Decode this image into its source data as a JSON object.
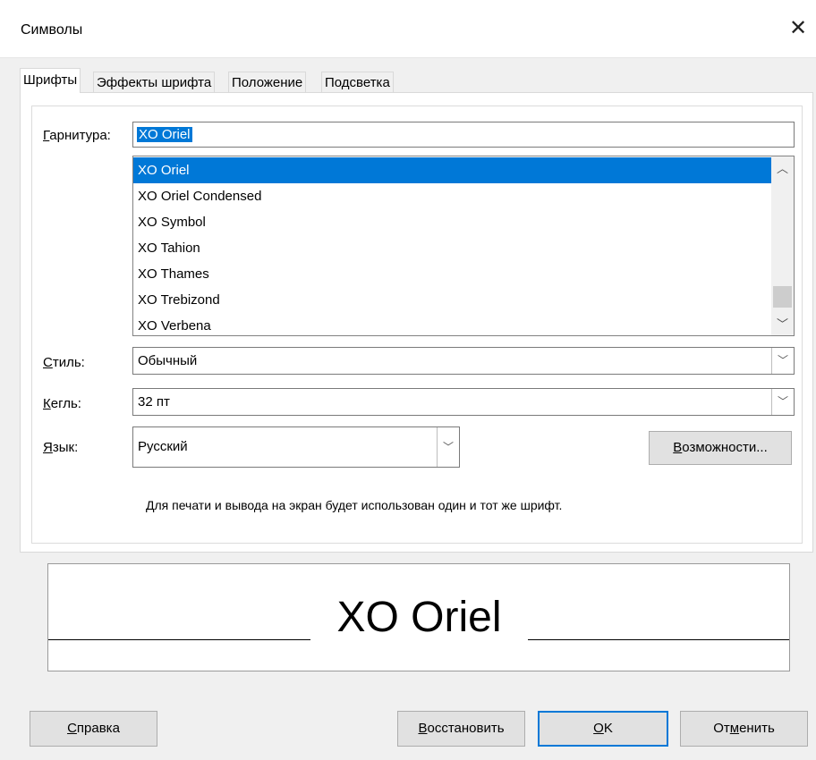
{
  "window": {
    "title": "Символы",
    "close_glyph": "✕"
  },
  "tabs": [
    {
      "label": "Шрифты",
      "active": true
    },
    {
      "label": "Эффекты шрифта",
      "active": false
    },
    {
      "label": "Положение",
      "active": false
    },
    {
      "label": "Подсветка",
      "active": false
    }
  ],
  "font": {
    "family_label_u": "Г",
    "family_label_rest": "арнитура:",
    "family_value": "XO Oriel",
    "family_list": [
      "XO Oriel",
      "XO Oriel Condensed",
      "XO Symbol",
      "XO Tahion",
      "XO Thames",
      "XO Trebizond",
      "XO Verbena"
    ],
    "selected_index": 0,
    "scroll_up_glyph": "︿",
    "scroll_down_glyph": "﹀",
    "style_label_u": "С",
    "style_label_rest": "тиль:",
    "style_value": "Обычный",
    "size_label_u": "К",
    "size_label_rest": "егль:",
    "size_value": "32 пт",
    "lang_label_u": "Я",
    "lang_label_rest": "зык:",
    "lang_value": "Русский",
    "features_button_u": "В",
    "features_button_rest": "озможности...",
    "info_text": "Для печати и вывода на экран будет использован один и тот же шрифт.",
    "dropdown_glyph": "﹀"
  },
  "preview": {
    "text": "XO Oriel"
  },
  "buttons": {
    "help_u": "С",
    "help_rest": "правка",
    "reset_u": "В",
    "reset_rest": "осстановить",
    "ok_u": "О",
    "ok_rest": "K",
    "cancel_pre": "От",
    "cancel_u": "м",
    "cancel_rest": "енить"
  },
  "colors": {
    "selection": "#0078d7",
    "default_button_border": "#0078d7"
  }
}
